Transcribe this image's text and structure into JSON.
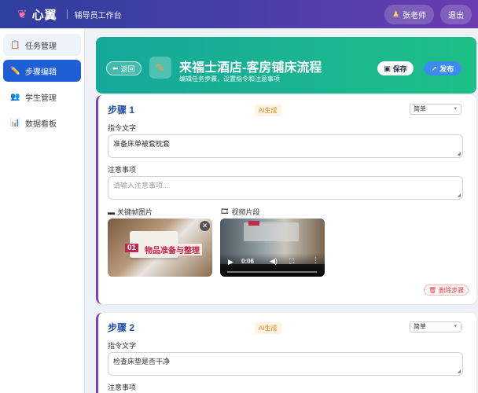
{
  "app": {
    "logo_icon": "butterfly-icon",
    "name": "心翼",
    "subtitle": "辅导员工作台"
  },
  "user": {
    "icon": "teacher-icon",
    "name": "张老师",
    "logout_label": "退出"
  },
  "sidebar": {
    "items": [
      {
        "icon": "clipboard-icon",
        "glyph": "📋",
        "label": "任务管理",
        "active": false
      },
      {
        "icon": "pencil-icon",
        "glyph": "✏️",
        "label": "步骤编辑",
        "active": true
      },
      {
        "icon": "users-icon",
        "glyph": "👥",
        "label": "学生管理",
        "active": false
      },
      {
        "icon": "chart-icon",
        "glyph": "📊",
        "label": "数据看板",
        "active": false
      }
    ]
  },
  "hero": {
    "back_label": "返回",
    "title": "来福士酒店-客房铺床流程",
    "subtitle": "编辑任务步骤，设置指令和注意事项",
    "save_label": "保存",
    "publish_label": "发布",
    "colors": {
      "start": "#14a89a",
      "end": "#1ebf88"
    }
  },
  "steps": [
    {
      "title": "步骤 1",
      "ai_badge": "AI生成",
      "difficulty": "简单",
      "instruction_label": "指令文字",
      "instruction_value": "准备床单被套枕套",
      "notes_label": "注意事项",
      "notes_placeholder": "请输入注意事项...",
      "keyframe_label": "关键帧图片",
      "keyframe_caption_num": "01",
      "keyframe_caption_text": "物品准备与整理",
      "video_label": "视频片段",
      "video_time": "0:06",
      "delete_label": "删除步骤"
    },
    {
      "title": "步骤 2",
      "ai_badge": "AI生成",
      "difficulty": "简单",
      "instruction_label": "指令文字",
      "instruction_value": "检查床垫是否干净",
      "notes_label": "注意事项"
    }
  ],
  "colors": {
    "topbar_start": "#2e3f9e",
    "topbar_end": "#6a3cb0",
    "accent_blue": "#1f5fd6",
    "step_title": "#1f4fa8",
    "card_border": "#7b3fc0",
    "delete_red": "#d94848"
  }
}
